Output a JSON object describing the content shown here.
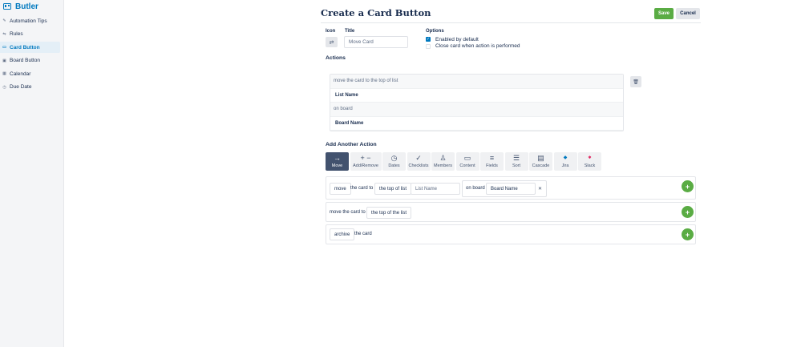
{
  "app": {
    "name": "Butler"
  },
  "sidebar": {
    "items": [
      {
        "label": "Automation Tips",
        "icon": "magic-wand-icon",
        "glyph": "✎",
        "active": false
      },
      {
        "label": "Rules",
        "icon": "rules-icon",
        "glyph": "⇋",
        "active": false
      },
      {
        "label": "Card Button",
        "icon": "card-icon",
        "glyph": "▭",
        "active": true
      },
      {
        "label": "Board Button",
        "icon": "board-icon",
        "glyph": "▣",
        "active": false
      },
      {
        "label": "Calendar",
        "icon": "calendar-icon",
        "glyph": "▦",
        "active": false
      },
      {
        "label": "Due Date",
        "icon": "clock-icon",
        "glyph": "◷",
        "active": false
      }
    ]
  },
  "header": {
    "title": "Create a Card Button",
    "save_label": "Save",
    "cancel_label": "Cancel"
  },
  "form": {
    "icon_label": "Icon",
    "icon_glyph": "⇄",
    "title_label": "Title",
    "title_placeholder": "Move Card",
    "options_label": "Options",
    "options": [
      {
        "label": "Enabled by default",
        "checked": true
      },
      {
        "label": "Close card when action is performed",
        "checked": false
      }
    ]
  },
  "actions": {
    "label": "Actions",
    "rows": [
      "move the card to the top of list",
      "List Name",
      "on board",
      "Board Name"
    ],
    "trash_glyph": "🗑"
  },
  "add_action": {
    "label": "Add Another Action",
    "tabs": [
      {
        "label": "Move",
        "glyph": "→",
        "icon": "arrow-right-icon"
      },
      {
        "label": "Add/Remove",
        "glyph": "+ −",
        "icon": "plus-minus-icon"
      },
      {
        "label": "Dates",
        "glyph": "◷",
        "icon": "clock-icon"
      },
      {
        "label": "Checklists",
        "glyph": "✓",
        "icon": "check-icon"
      },
      {
        "label": "Members",
        "glyph": "♙",
        "icon": "person-icon"
      },
      {
        "label": "Content",
        "glyph": "▭",
        "icon": "comment-icon"
      },
      {
        "label": "Fields",
        "glyph": "≡",
        "icon": "fields-icon"
      },
      {
        "label": "Sort",
        "glyph": "☰",
        "icon": "sort-icon"
      },
      {
        "label": "Cascade",
        "glyph": "▤",
        "icon": "cascade-icon"
      },
      {
        "label": "Jira",
        "glyph": "◆",
        "icon": "jira-icon"
      },
      {
        "label": "Slack",
        "glyph": "✱",
        "icon": "slack-icon"
      }
    ]
  },
  "builder": {
    "row1": {
      "verb": "move",
      "t1": "the card to",
      "pos": "the top of list",
      "list_placeholder": "List Name",
      "t2": "on board",
      "board_placeholder": "Board Name",
      "x": "✕"
    },
    "row2": {
      "t1": "move the card to",
      "pos": "the top of the list"
    },
    "row3": {
      "verb": "archive",
      "t1": "the card"
    },
    "plus": "+"
  }
}
